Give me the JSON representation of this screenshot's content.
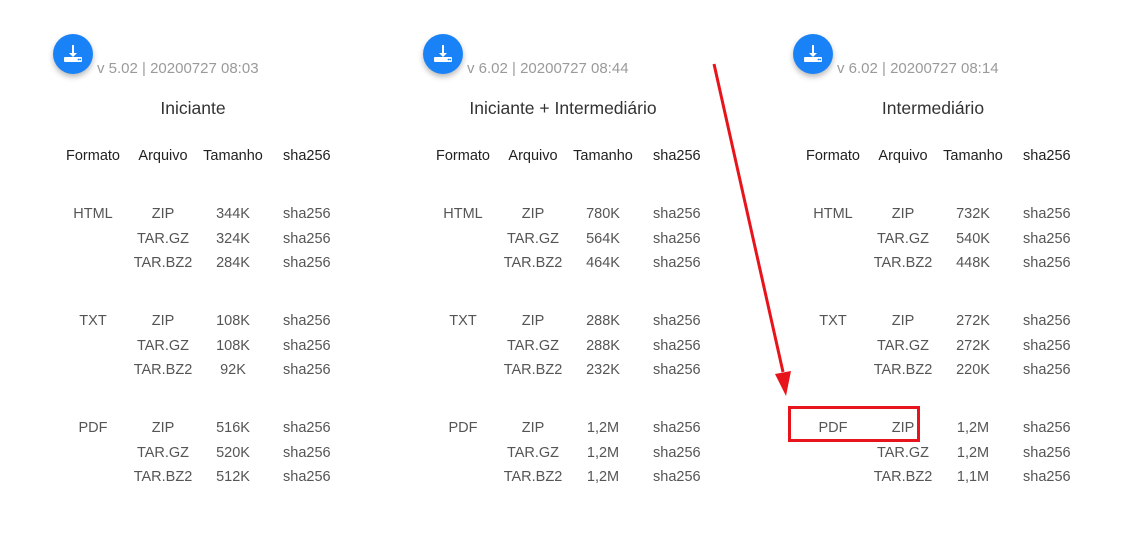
{
  "panels": [
    {
      "version": "v 5.02 | 20200727 08:03",
      "title": "Iniciante",
      "headers": [
        "Formato",
        "Arquivo",
        "Tamanho",
        "sha256"
      ],
      "groups": [
        {
          "format": "HTML",
          "rows": [
            {
              "archive": "ZIP",
              "size": "344K",
              "sha": "sha256"
            },
            {
              "archive": "TAR.GZ",
              "size": "324K",
              "sha": "sha256"
            },
            {
              "archive": "TAR.BZ2",
              "size": "284K",
              "sha": "sha256"
            }
          ]
        },
        {
          "format": "TXT",
          "rows": [
            {
              "archive": "ZIP",
              "size": "108K",
              "sha": "sha256"
            },
            {
              "archive": "TAR.GZ",
              "size": "108K",
              "sha": "sha256"
            },
            {
              "archive": "TAR.BZ2",
              "size": "92K",
              "sha": "sha256"
            }
          ]
        },
        {
          "format": "PDF",
          "rows": [
            {
              "archive": "ZIP",
              "size": "516K",
              "sha": "sha256"
            },
            {
              "archive": "TAR.GZ",
              "size": "520K",
              "sha": "sha256"
            },
            {
              "archive": "TAR.BZ2",
              "size": "512K",
              "sha": "sha256"
            }
          ]
        }
      ]
    },
    {
      "version": "v 6.02 | 20200727 08:44",
      "title": "Iniciante + Intermediário",
      "headers": [
        "Formato",
        "Arquivo",
        "Tamanho",
        "sha256"
      ],
      "groups": [
        {
          "format": "HTML",
          "rows": [
            {
              "archive": "ZIP",
              "size": "780K",
              "sha": "sha256"
            },
            {
              "archive": "TAR.GZ",
              "size": "564K",
              "sha": "sha256"
            },
            {
              "archive": "TAR.BZ2",
              "size": "464K",
              "sha": "sha256"
            }
          ]
        },
        {
          "format": "TXT",
          "rows": [
            {
              "archive": "ZIP",
              "size": "288K",
              "sha": "sha256"
            },
            {
              "archive": "TAR.GZ",
              "size": "288K",
              "sha": "sha256"
            },
            {
              "archive": "TAR.BZ2",
              "size": "232K",
              "sha": "sha256"
            }
          ]
        },
        {
          "format": "PDF",
          "rows": [
            {
              "archive": "ZIP",
              "size": "1,2M",
              "sha": "sha256"
            },
            {
              "archive": "TAR.GZ",
              "size": "1,2M",
              "sha": "sha256"
            },
            {
              "archive": "TAR.BZ2",
              "size": "1,2M",
              "sha": "sha256"
            }
          ]
        }
      ]
    },
    {
      "version": "v 6.02 | 20200727 08:14",
      "title": "Intermediário",
      "headers": [
        "Formato",
        "Arquivo",
        "Tamanho",
        "sha256"
      ],
      "groups": [
        {
          "format": "HTML",
          "rows": [
            {
              "archive": "ZIP",
              "size": "732K",
              "sha": "sha256"
            },
            {
              "archive": "TAR.GZ",
              "size": "540K",
              "sha": "sha256"
            },
            {
              "archive": "TAR.BZ2",
              "size": "448K",
              "sha": "sha256"
            }
          ]
        },
        {
          "format": "TXT",
          "rows": [
            {
              "archive": "ZIP",
              "size": "272K",
              "sha": "sha256"
            },
            {
              "archive": "TAR.GZ",
              "size": "272K",
              "sha": "sha256"
            },
            {
              "archive": "TAR.BZ2",
              "size": "220K",
              "sha": "sha256"
            }
          ]
        },
        {
          "format": "PDF",
          "rows": [
            {
              "archive": "ZIP",
              "size": "1,2M",
              "sha": "sha256"
            },
            {
              "archive": "TAR.GZ",
              "size": "1,2M",
              "sha": "sha256"
            },
            {
              "archive": "TAR.BZ2",
              "size": "1,1M",
              "sha": "sha256"
            }
          ]
        }
      ]
    }
  ],
  "icons": {
    "download": "download-icon"
  },
  "colors": {
    "accent": "#1a82f7",
    "annotation": "#e8141b",
    "version_text": "#9a9a9a"
  }
}
